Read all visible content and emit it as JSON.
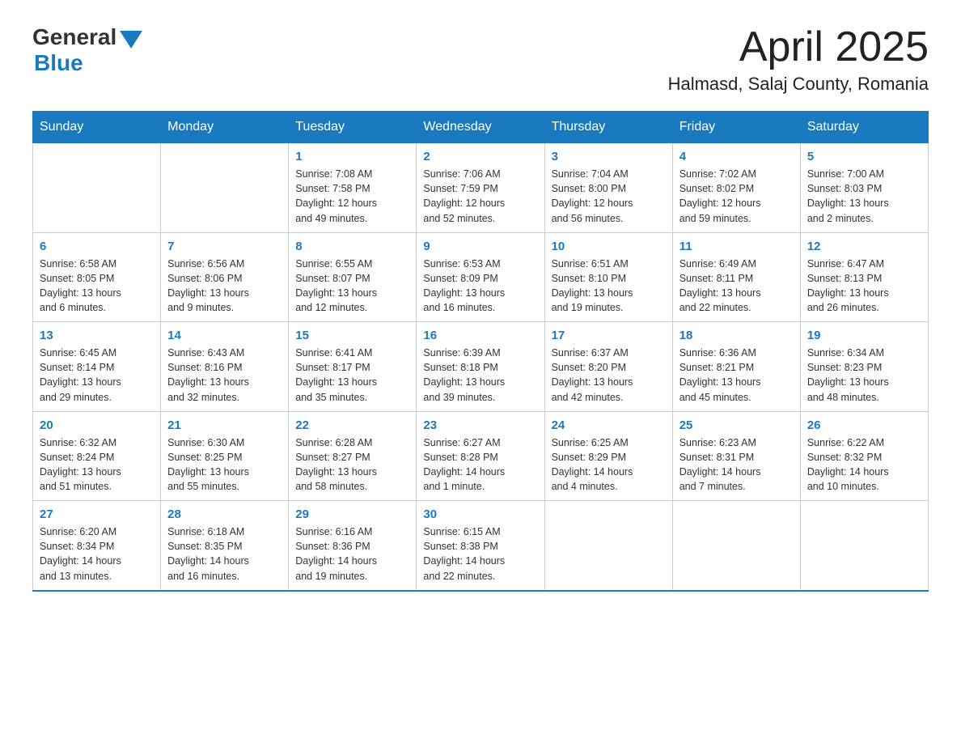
{
  "logo": {
    "general": "General",
    "blue": "Blue"
  },
  "title": "April 2025",
  "subtitle": "Halmasd, Salaj County, Romania",
  "headers": [
    "Sunday",
    "Monday",
    "Tuesday",
    "Wednesday",
    "Thursday",
    "Friday",
    "Saturday"
  ],
  "weeks": [
    [
      {
        "day": "",
        "info": ""
      },
      {
        "day": "",
        "info": ""
      },
      {
        "day": "1",
        "info": "Sunrise: 7:08 AM\nSunset: 7:58 PM\nDaylight: 12 hours\nand 49 minutes."
      },
      {
        "day": "2",
        "info": "Sunrise: 7:06 AM\nSunset: 7:59 PM\nDaylight: 12 hours\nand 52 minutes."
      },
      {
        "day": "3",
        "info": "Sunrise: 7:04 AM\nSunset: 8:00 PM\nDaylight: 12 hours\nand 56 minutes."
      },
      {
        "day": "4",
        "info": "Sunrise: 7:02 AM\nSunset: 8:02 PM\nDaylight: 12 hours\nand 59 minutes."
      },
      {
        "day": "5",
        "info": "Sunrise: 7:00 AM\nSunset: 8:03 PM\nDaylight: 13 hours\nand 2 minutes."
      }
    ],
    [
      {
        "day": "6",
        "info": "Sunrise: 6:58 AM\nSunset: 8:05 PM\nDaylight: 13 hours\nand 6 minutes."
      },
      {
        "day": "7",
        "info": "Sunrise: 6:56 AM\nSunset: 8:06 PM\nDaylight: 13 hours\nand 9 minutes."
      },
      {
        "day": "8",
        "info": "Sunrise: 6:55 AM\nSunset: 8:07 PM\nDaylight: 13 hours\nand 12 minutes."
      },
      {
        "day": "9",
        "info": "Sunrise: 6:53 AM\nSunset: 8:09 PM\nDaylight: 13 hours\nand 16 minutes."
      },
      {
        "day": "10",
        "info": "Sunrise: 6:51 AM\nSunset: 8:10 PM\nDaylight: 13 hours\nand 19 minutes."
      },
      {
        "day": "11",
        "info": "Sunrise: 6:49 AM\nSunset: 8:11 PM\nDaylight: 13 hours\nand 22 minutes."
      },
      {
        "day": "12",
        "info": "Sunrise: 6:47 AM\nSunset: 8:13 PM\nDaylight: 13 hours\nand 26 minutes."
      }
    ],
    [
      {
        "day": "13",
        "info": "Sunrise: 6:45 AM\nSunset: 8:14 PM\nDaylight: 13 hours\nand 29 minutes."
      },
      {
        "day": "14",
        "info": "Sunrise: 6:43 AM\nSunset: 8:16 PM\nDaylight: 13 hours\nand 32 minutes."
      },
      {
        "day": "15",
        "info": "Sunrise: 6:41 AM\nSunset: 8:17 PM\nDaylight: 13 hours\nand 35 minutes."
      },
      {
        "day": "16",
        "info": "Sunrise: 6:39 AM\nSunset: 8:18 PM\nDaylight: 13 hours\nand 39 minutes."
      },
      {
        "day": "17",
        "info": "Sunrise: 6:37 AM\nSunset: 8:20 PM\nDaylight: 13 hours\nand 42 minutes."
      },
      {
        "day": "18",
        "info": "Sunrise: 6:36 AM\nSunset: 8:21 PM\nDaylight: 13 hours\nand 45 minutes."
      },
      {
        "day": "19",
        "info": "Sunrise: 6:34 AM\nSunset: 8:23 PM\nDaylight: 13 hours\nand 48 minutes."
      }
    ],
    [
      {
        "day": "20",
        "info": "Sunrise: 6:32 AM\nSunset: 8:24 PM\nDaylight: 13 hours\nand 51 minutes."
      },
      {
        "day": "21",
        "info": "Sunrise: 6:30 AM\nSunset: 8:25 PM\nDaylight: 13 hours\nand 55 minutes."
      },
      {
        "day": "22",
        "info": "Sunrise: 6:28 AM\nSunset: 8:27 PM\nDaylight: 13 hours\nand 58 minutes."
      },
      {
        "day": "23",
        "info": "Sunrise: 6:27 AM\nSunset: 8:28 PM\nDaylight: 14 hours\nand 1 minute."
      },
      {
        "day": "24",
        "info": "Sunrise: 6:25 AM\nSunset: 8:29 PM\nDaylight: 14 hours\nand 4 minutes."
      },
      {
        "day": "25",
        "info": "Sunrise: 6:23 AM\nSunset: 8:31 PM\nDaylight: 14 hours\nand 7 minutes."
      },
      {
        "day": "26",
        "info": "Sunrise: 6:22 AM\nSunset: 8:32 PM\nDaylight: 14 hours\nand 10 minutes."
      }
    ],
    [
      {
        "day": "27",
        "info": "Sunrise: 6:20 AM\nSunset: 8:34 PM\nDaylight: 14 hours\nand 13 minutes."
      },
      {
        "day": "28",
        "info": "Sunrise: 6:18 AM\nSunset: 8:35 PM\nDaylight: 14 hours\nand 16 minutes."
      },
      {
        "day": "29",
        "info": "Sunrise: 6:16 AM\nSunset: 8:36 PM\nDaylight: 14 hours\nand 19 minutes."
      },
      {
        "day": "30",
        "info": "Sunrise: 6:15 AM\nSunset: 8:38 PM\nDaylight: 14 hours\nand 22 minutes."
      },
      {
        "day": "",
        "info": ""
      },
      {
        "day": "",
        "info": ""
      },
      {
        "day": "",
        "info": ""
      }
    ]
  ]
}
